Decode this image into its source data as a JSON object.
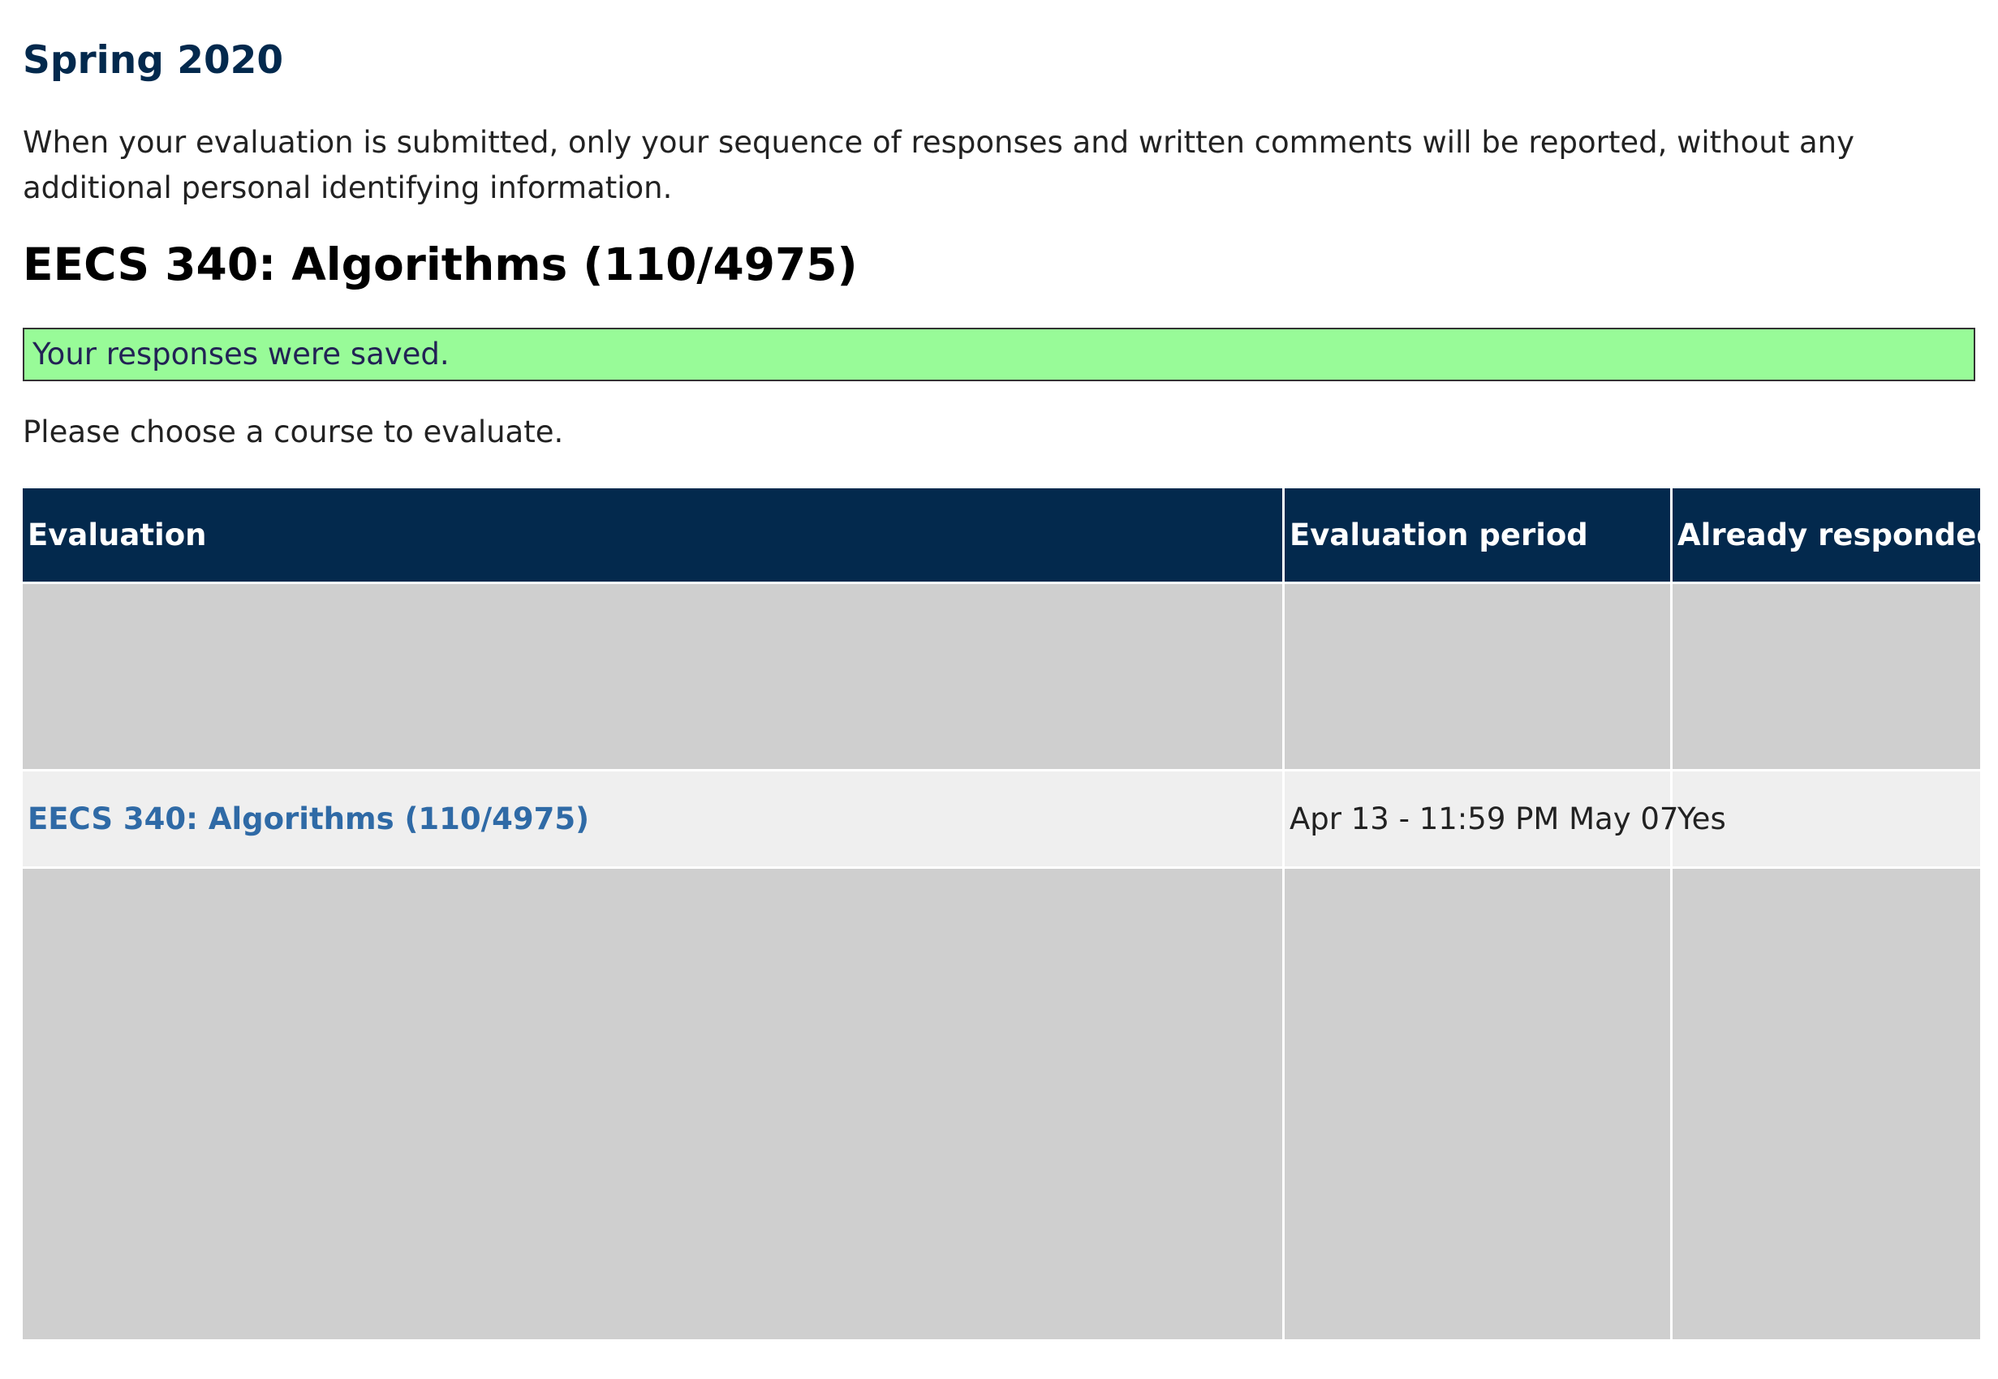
{
  "term": {
    "title": "Spring 2020"
  },
  "notice": "When your evaluation is submitted, only your sequence of responses and written comments will be reported, without any additional personal identifying information.",
  "course": {
    "title": "EECS 340: Algorithms (110/4975)"
  },
  "status": {
    "saved_message": "Your responses were saved.",
    "banner_color": "#98fb98"
  },
  "instruction": "Please choose a course to evaluate.",
  "table": {
    "headers": {
      "evaluation": "Evaluation",
      "period": "Evaluation period",
      "responded": "Already responded?"
    },
    "header_color": "#03294d",
    "rows": [
      {
        "evaluation": "EECS 340: Algorithms (110/4975)",
        "period": "Apr 13 - 11:59 PM May 07",
        "responded": "Yes"
      }
    ]
  },
  "colors": {
    "heading": "#03294d",
    "link": "#2f6aa6",
    "row_background": "#efefef"
  }
}
